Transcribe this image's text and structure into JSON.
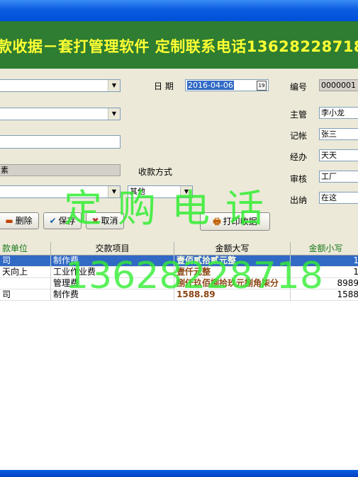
{
  "banner": {
    "title": "款收据－套打管理软件  定制联系电话13628228718"
  },
  "form": {
    "date_label": "日  期",
    "date_value": "2016-04-06",
    "number_label": "编号",
    "number_value": "0000001",
    "supervisor_label": "主管",
    "supervisor_value": "李小龙",
    "bookkeeper_label": "记帐",
    "bookkeeper_value": "张三",
    "handler_label": "经办",
    "handler_value": "天天",
    "auditor_label": "审核",
    "auditor_value": "工厂",
    "cashier_label": "出纳",
    "cashier_value": "在这",
    "partial_label": "素",
    "payment_method_label": "收款方式",
    "payment_method_value": "其他"
  },
  "toolbar": {
    "delete_label": "删除",
    "save_label": "保存",
    "cancel_label": "取消",
    "print_label": "打印收据"
  },
  "grid": {
    "headers": [
      "款单位",
      "交款项目",
      "金额大写",
      "金额小写"
    ],
    "rows": [
      {
        "unit": "司",
        "item": "制作费",
        "upper": "壹佰贰拾贰元整",
        "lower": "1"
      },
      {
        "unit": "天向上",
        "item": "工业作业费",
        "upper": "壹仟元整",
        "lower": "1"
      },
      {
        "unit": "",
        "item": "管理费",
        "upper": "捌仟玖佰捌拾玖元捌角柒分",
        "lower": "8989"
      },
      {
        "unit": "司",
        "item": "制作费",
        "upper": "1588.89",
        "lower": "1588"
      }
    ]
  },
  "watermark": {
    "line1": "定购电话",
    "line2": "13628228718"
  },
  "colors": {
    "banner_bg": "#2e7d32",
    "banner_text": "#ffff33",
    "selection": "#316ac5",
    "watermark": "#33ee33"
  }
}
